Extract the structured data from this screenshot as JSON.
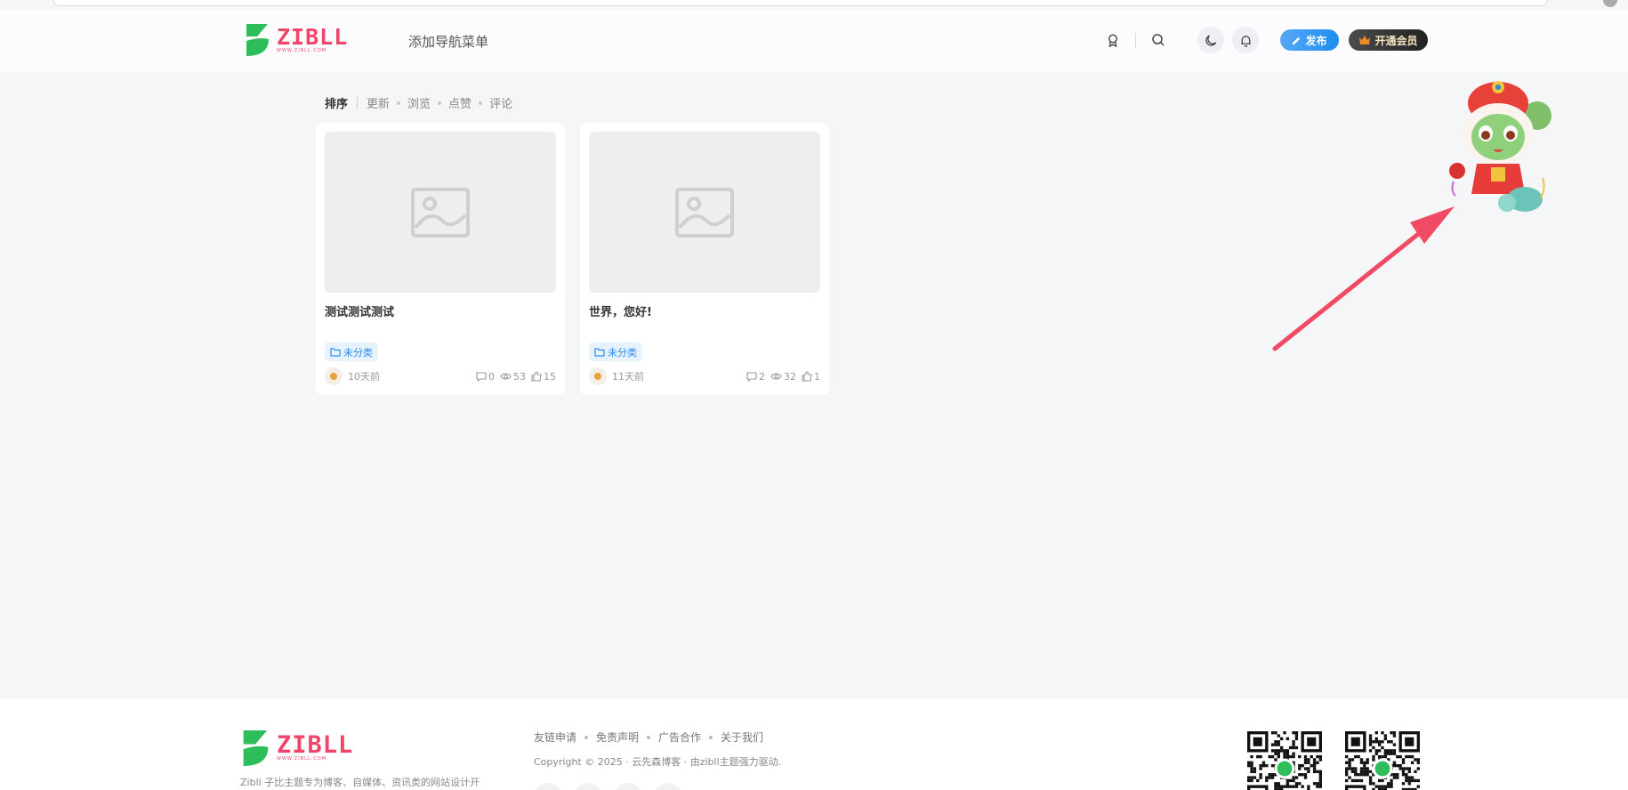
{
  "header": {
    "logo_text": "ZIBLL",
    "logo_url": "WWW.ZIBLL.COM",
    "nav_menu_label": "添加导航菜单",
    "publish_label": "发布",
    "vip_label": "开通会员"
  },
  "sort": {
    "title": "排序",
    "options": [
      "更新",
      "浏览",
      "点赞",
      "评论"
    ]
  },
  "posts": [
    {
      "title": "测试测试测试",
      "category": "未分类",
      "time": "10天前",
      "comments": "0",
      "views": "53",
      "likes": "15"
    },
    {
      "title": "世界，您好!",
      "category": "未分类",
      "time": "11天前",
      "comments": "2",
      "views": "32",
      "likes": "1"
    }
  ],
  "footer": {
    "logo_text": "ZIBLL",
    "logo_url": "WWW.ZIBLL.COM",
    "description": "Zibll 子比主题专为博客、自媒体、资讯类的网站设计开",
    "links": [
      "友链申请",
      "免责声明",
      "广告合作",
      "关于我们"
    ],
    "copyright": "Copyright © 2025 · 云先森博客 · 由zibll主题强力驱动."
  },
  "colors": {
    "brand_green": "#2dbd5a",
    "brand_pink": "#f0466b",
    "publish_blue": "#1e8ef0",
    "badge_blue": "#2d8cf0",
    "arrow_red": "#f04a64"
  },
  "icons": [
    "medal-icon",
    "search-icon",
    "moon-icon",
    "bell-icon",
    "pencil-icon",
    "crown-icon",
    "image-placeholder-icon",
    "folder-icon",
    "comment-icon",
    "eye-icon",
    "thumb-up-icon"
  ]
}
